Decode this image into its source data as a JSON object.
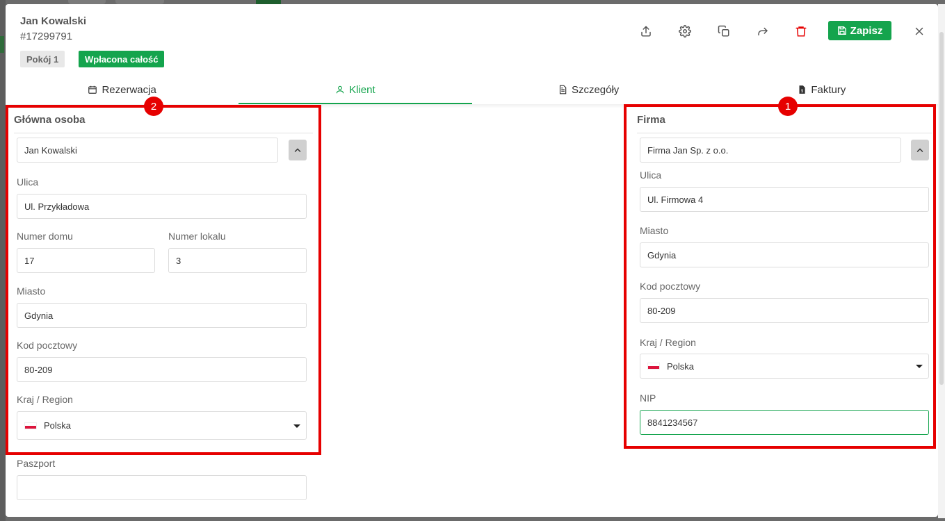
{
  "header": {
    "guest_name": "Jan Kowalski",
    "reservation_id": "#17299791",
    "room_badge": "Pokój 1",
    "payment_badge": "Wpłacona całość",
    "save_label": "Zapisz",
    "toolbar_icons": [
      "upload-icon",
      "gear-icon",
      "copy-icon",
      "share-icon",
      "trash-icon",
      "save-icon",
      "close-icon"
    ]
  },
  "tabs": [
    {
      "label": "Rezerwacja",
      "icon": "calendar-icon",
      "active": false
    },
    {
      "label": "Klient",
      "icon": "user-icon",
      "active": true
    },
    {
      "label": "Szczegóły",
      "icon": "document-icon",
      "active": false
    },
    {
      "label": "Faktury",
      "icon": "invoice-icon",
      "active": false
    }
  ],
  "main_person": {
    "title": "Główna osoba",
    "name": "Jan Kowalski",
    "street_label": "Ulica",
    "street": "Ul. Przykładowa",
    "house_label": "Numer domu",
    "house": "17",
    "flat_label": "Numer lokalu",
    "flat": "3",
    "city_label": "Miasto",
    "city": "Gdynia",
    "postal_label": "Kod pocztowy",
    "postal": "80-209",
    "country_label": "Kraj / Region",
    "country": "Polska",
    "passport_label": "Paszport",
    "passport": ""
  },
  "company": {
    "title": "Firma",
    "name": "Firma Jan Sp. z o.o.",
    "street_label": "Ulica",
    "street": "Ul. Firmowa 4",
    "city_label": "Miasto",
    "city": "Gdynia",
    "postal_label": "Kod pocztowy",
    "postal": "80-209",
    "country_label": "Kraj / Region",
    "country": "Polska",
    "nip_label": "NIP",
    "nip": "8841234567"
  },
  "annotations": {
    "marker_1": "1",
    "marker_2": "2",
    "highlight_color": "#e60000"
  },
  "colors": {
    "accent": "#14a44d",
    "danger": "#e60000"
  }
}
